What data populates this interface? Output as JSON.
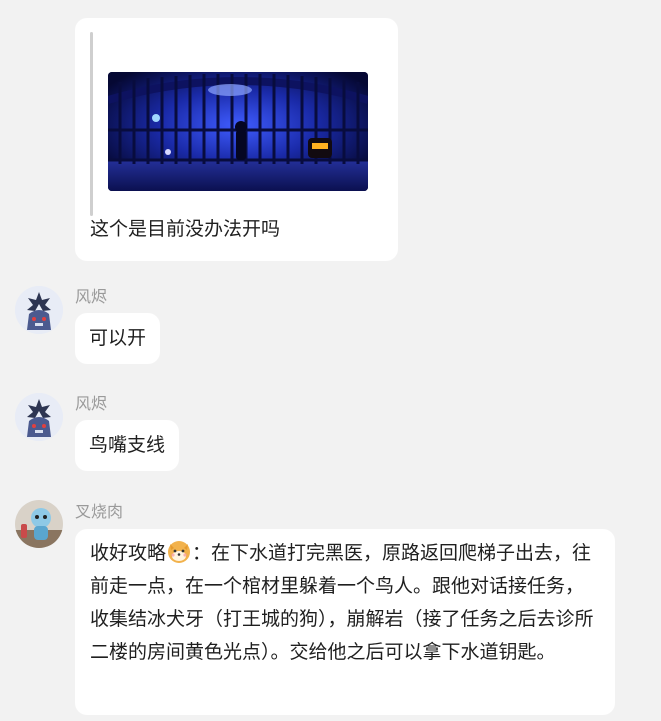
{
  "quote": {
    "text": "这个是目前没办法开吗",
    "image_icon": "game-screenshot-blue-prison-gate"
  },
  "messages": [
    {
      "sender": "风烬",
      "text": "可以开",
      "avatar_icon": "rabbit-knight-avatar"
    },
    {
      "sender": "风烬",
      "text": "鸟嘴支线",
      "avatar_icon": "rabbit-knight-avatar"
    },
    {
      "sender": "叉烧肉",
      "avatar_icon": "figurine-avatar",
      "prefix": "收好攻略",
      "emoji_icon": "shiba-dog-emoji",
      "text": "：在下水道打完黑医，原路返回爬梯子出去，往前走一点，在一个棺材里躲着一个鸟人。跟他对话接任务，收集结冰犬牙（打王城的狗），崩解岩（接了任务之后去诊所二楼的房间黄色光点）。交给他之后可以拿下水道钥匙。"
    }
  ],
  "colors": {
    "background": "#f2f2f2",
    "bubble": "#ffffff",
    "text": "#1f1f1f",
    "sender": "#9a9a9a"
  }
}
